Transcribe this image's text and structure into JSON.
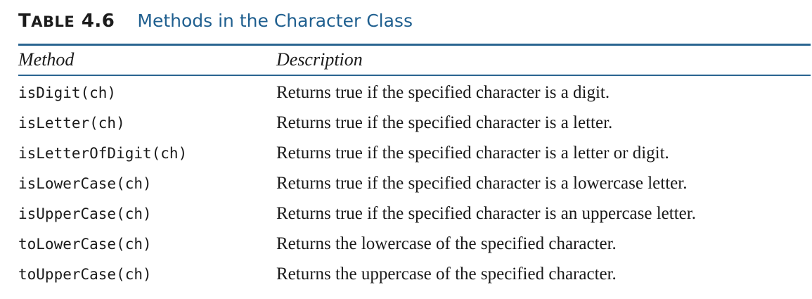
{
  "caption": {
    "label_first": "T",
    "label_rest": "ABLE",
    "label_number": "4.6",
    "title": "Methods in the Character Class"
  },
  "table": {
    "headers": {
      "method": "Method",
      "description": "Description"
    },
    "rows": [
      {
        "method": "isDigit(ch)",
        "description": "Returns true if the specified character is a digit."
      },
      {
        "method": "isLetter(ch)",
        "description": "Returns true if the specified character is a letter."
      },
      {
        "method": "isLetterOfDigit(ch)",
        "description": "Returns true if the specified character is a letter or digit."
      },
      {
        "method": "isLowerCase(ch)",
        "description": "Returns true if the specified character is a lowercase letter."
      },
      {
        "method": "isUpperCase(ch)",
        "description": "Returns true if the specified character is an uppercase letter."
      },
      {
        "method": "toLowerCase(ch)",
        "description": "Returns the lowercase of the specified character."
      },
      {
        "method": "toUpperCase(ch)",
        "description": "Returns the uppercase of the specified character."
      }
    ]
  },
  "colors": {
    "accent": "#2a6591",
    "title": "#1f5f8f",
    "text": "#1a1a1a"
  }
}
